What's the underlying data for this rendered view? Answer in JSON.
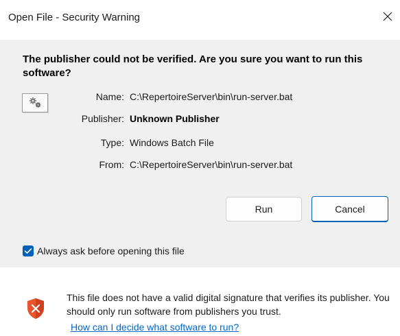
{
  "window": {
    "title": "Open File - Security Warning"
  },
  "warning": {
    "heading": "The publisher could not be verified.  Are you sure you want to run this software?"
  },
  "file_info": {
    "rows": [
      {
        "label": "Name:",
        "value": "C:\\RepertoireServer\\bin\\run-server.bat",
        "bold": false
      },
      {
        "label": "Publisher:",
        "value": "Unknown Publisher",
        "bold": true
      },
      {
        "label": "Type:",
        "value": "Windows Batch File",
        "bold": false
      },
      {
        "label": "From:",
        "value": "C:\\RepertoireServer\\bin\\run-server.bat",
        "bold": false
      }
    ]
  },
  "buttons": {
    "run": "Run",
    "cancel": "Cancel"
  },
  "checkbox": {
    "label": "Always ask before opening this file",
    "checked": true
  },
  "footer": {
    "text": "This file does not have a valid digital signature that verifies its publisher.  You should only run software from publishers you trust.",
    "link": "How can I decide what software to run?"
  },
  "icons": {
    "file": "settings-gears-icon",
    "shield": "shield-warning-icon",
    "close": "close-icon",
    "check": "checkmark-icon"
  },
  "colors": {
    "accent": "#005fb8",
    "link": "#0066cc",
    "shield": "#e8542e",
    "content_bg": "#f0f0f0"
  }
}
